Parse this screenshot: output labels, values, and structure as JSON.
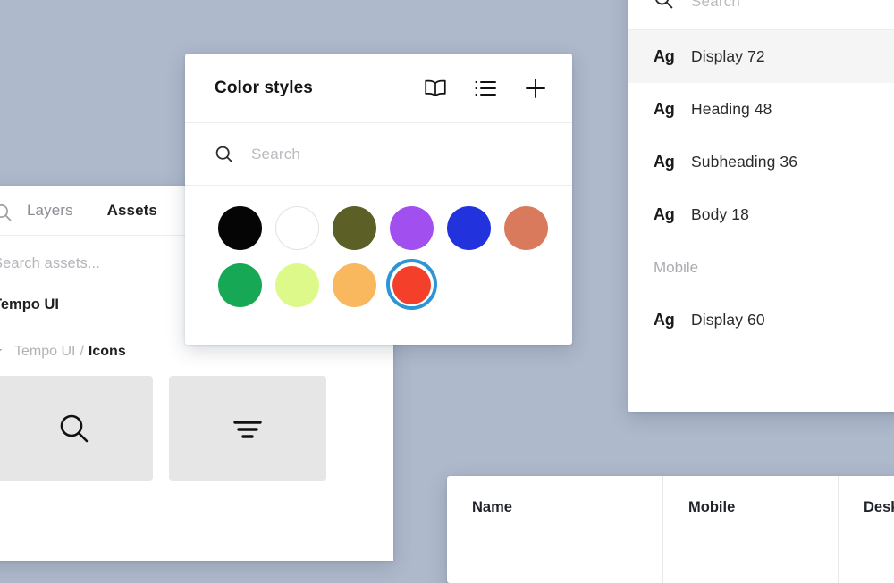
{
  "canvas": {
    "background_color": "#aeb9cb"
  },
  "assets_panel": {
    "search_icon": "search-icon",
    "tabs": [
      {
        "label": "Layers",
        "active": false
      },
      {
        "label": "Assets",
        "active": true
      }
    ],
    "search_placeholder": "Search assets...",
    "library_name": "Tempo UI",
    "group": {
      "caret_icon": "caret-down-icon",
      "parent": "Tempo UI",
      "separator": "/",
      "name": "Icons"
    },
    "thumbnails": [
      {
        "icon": "search-icon"
      },
      {
        "icon": "filter-icon"
      }
    ]
  },
  "color_styles_panel": {
    "title": "Color styles",
    "actions": [
      {
        "icon": "book-icon",
        "name": "library-button"
      },
      {
        "icon": "list-icon",
        "name": "list-view-button"
      },
      {
        "icon": "plus-icon",
        "name": "add-style-button"
      }
    ],
    "search_icon": "search-icon",
    "search_placeholder": "Search",
    "swatches": [
      {
        "color": "#050505",
        "outlined": false,
        "selected": false
      },
      {
        "color": "#ffffff",
        "outlined": true,
        "selected": false
      },
      {
        "color": "#5d6026",
        "outlined": false,
        "selected": false
      },
      {
        "color": "#a24ff0",
        "outlined": false,
        "selected": false
      },
      {
        "color": "#2233dd",
        "outlined": false,
        "selected": false
      },
      {
        "color": "#d97a5c",
        "outlined": false,
        "selected": false
      },
      {
        "color": "#17a855",
        "outlined": false,
        "selected": false
      },
      {
        "color": "#dcf98a",
        "outlined": false,
        "selected": false
      },
      {
        "color": "#f9b75e",
        "outlined": false,
        "selected": false
      },
      {
        "color": "#f4402a",
        "outlined": false,
        "selected": true
      }
    ],
    "selection_ring_color": "#2b95d6"
  },
  "text_styles_panel": {
    "search_icon": "search-icon",
    "search_placeholder": "Search",
    "rows": [
      {
        "type": "style",
        "sample": "Ag",
        "label": "Display 72",
        "selected": true
      },
      {
        "type": "style",
        "sample": "Ag",
        "label": "Heading 48",
        "selected": false
      },
      {
        "type": "style",
        "sample": "Ag",
        "label": "Subheading 36",
        "selected": false
      },
      {
        "type": "style",
        "sample": "Ag",
        "label": "Body 18",
        "selected": false
      },
      {
        "type": "group",
        "label": "Mobile"
      },
      {
        "type": "style",
        "sample": "Ag",
        "label": "Display 60",
        "selected": false
      }
    ]
  },
  "table_panel": {
    "columns": [
      "Name",
      "Mobile",
      "Desktop"
    ]
  }
}
